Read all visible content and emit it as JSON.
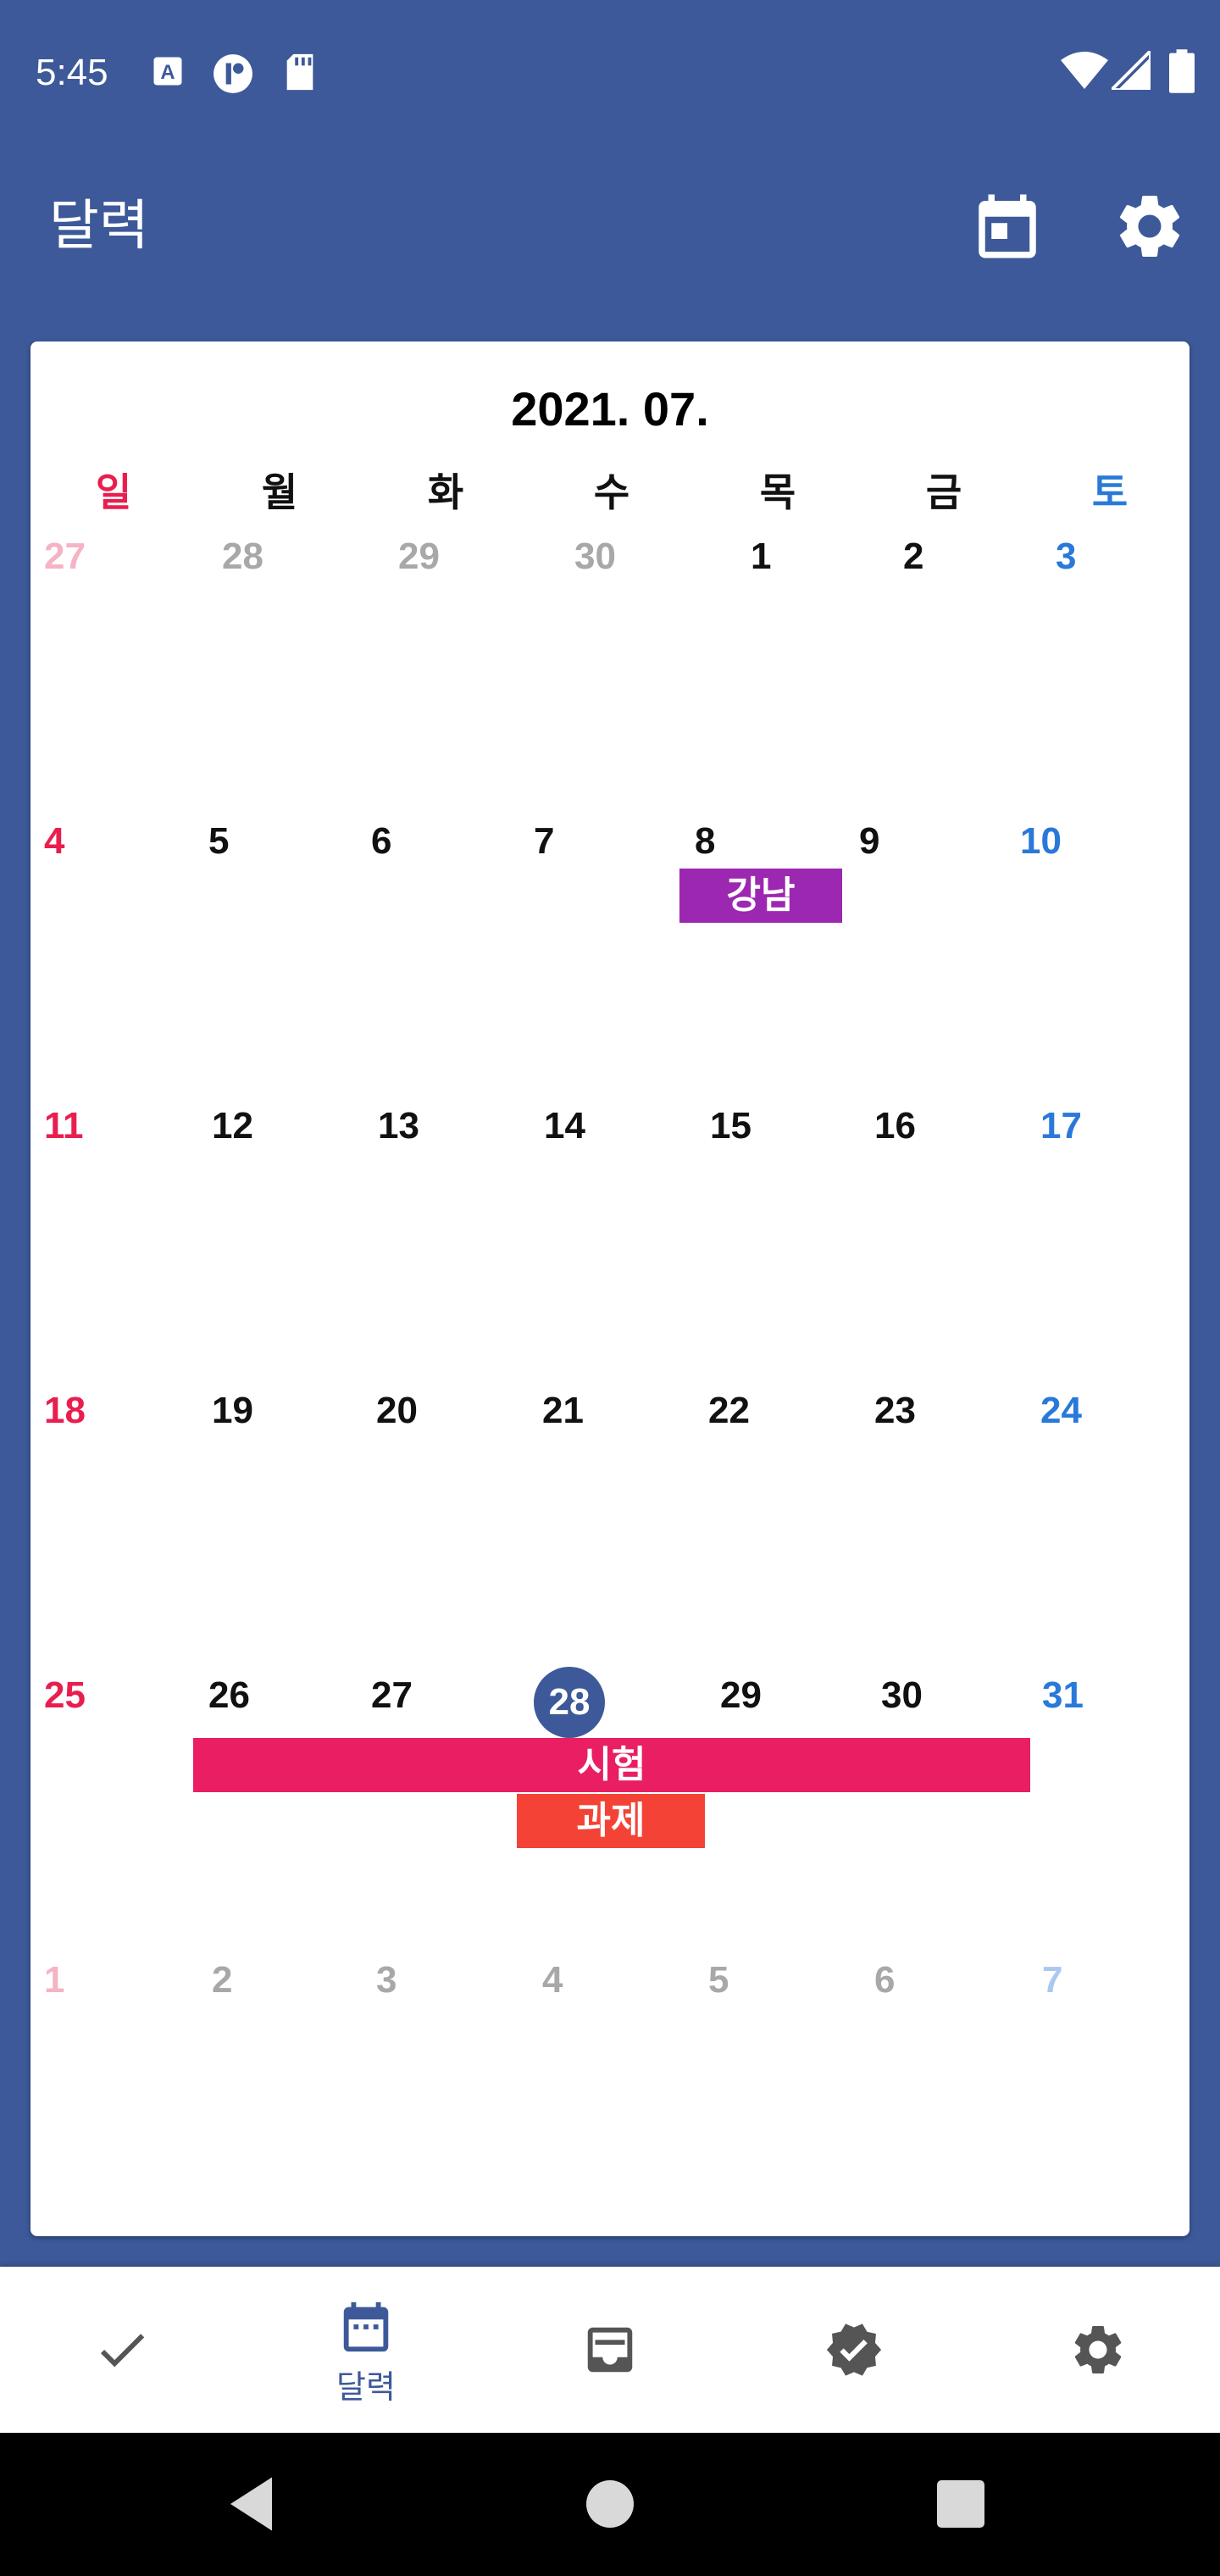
{
  "status_bar": {
    "time": "5:45",
    "icons": [
      "keyboard-a-icon",
      "app-circle-icon",
      "sd-card-icon",
      "wifi-icon",
      "signal-icon",
      "battery-icon"
    ]
  },
  "app_bar": {
    "title": "달력",
    "actions": [
      "calendar-today-icon",
      "settings-icon"
    ]
  },
  "calendar": {
    "month_title": "2021. 07.",
    "weekdays": [
      "일",
      "월",
      "화",
      "수",
      "목",
      "금",
      "토"
    ],
    "weeks": [
      [
        "27",
        "28",
        "29",
        "30",
        "1",
        "2",
        "3"
      ],
      [
        "4",
        "5",
        "6",
        "7",
        "8",
        "9",
        "10"
      ],
      [
        "11",
        "12",
        "13",
        "14",
        "15",
        "16",
        "17"
      ],
      [
        "18",
        "19",
        "20",
        "21",
        "22",
        "23",
        "24"
      ],
      [
        "25",
        "26",
        "27",
        "28",
        "29",
        "30",
        "31"
      ],
      [
        "1",
        "2",
        "3",
        "4",
        "5",
        "6",
        "7"
      ]
    ],
    "today": "28",
    "events": [
      {
        "label": "강남",
        "color": "#9c27b0"
      },
      {
        "label": "시험",
        "color": "#e91e63"
      },
      {
        "label": "과제",
        "color": "#f44336"
      }
    ]
  },
  "colors": {
    "primary": "#3d5999",
    "sunday": "#e91e4f",
    "saturday": "#2979d9",
    "sunday_faded": "#f6b3c4",
    "saturday_faded": "#a9c9f2",
    "other_month": "#a8a8a8"
  },
  "bottom_nav": {
    "items": [
      {
        "icon": "check-icon",
        "label": ""
      },
      {
        "icon": "calendar-icon",
        "label": "달력"
      },
      {
        "icon": "inbox-icon",
        "label": ""
      },
      {
        "icon": "verified-icon",
        "label": ""
      },
      {
        "icon": "settings-icon",
        "label": ""
      }
    ]
  },
  "system_nav": [
    "back-icon",
    "home-icon",
    "recents-icon"
  ]
}
